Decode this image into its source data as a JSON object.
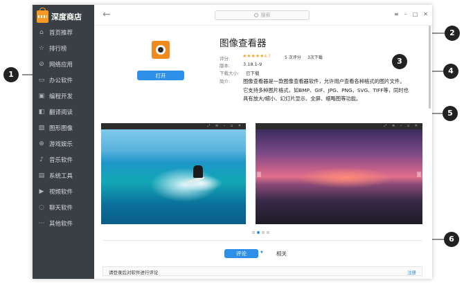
{
  "sidebar": {
    "brand": "深度商店",
    "items": [
      {
        "label": "首页推荐",
        "icon": "home-icon"
      },
      {
        "label": "排行榜",
        "icon": "star-icon"
      },
      {
        "label": "网络应用",
        "icon": "globe-icon"
      },
      {
        "label": "办公软件",
        "icon": "document-icon"
      },
      {
        "label": "编程开发",
        "icon": "code-icon"
      },
      {
        "label": "翻译阅读",
        "icon": "book-icon"
      },
      {
        "label": "图形图像",
        "icon": "image-icon"
      },
      {
        "label": "游戏娱乐",
        "icon": "gamepad-icon"
      },
      {
        "label": "音乐软件",
        "icon": "music-icon"
      },
      {
        "label": "系统工具",
        "icon": "tools-icon"
      },
      {
        "label": "视频软件",
        "icon": "video-icon"
      },
      {
        "label": "聊天软件",
        "icon": "chat-icon"
      },
      {
        "label": "其他软件",
        "icon": "more-icon"
      }
    ]
  },
  "titlebar": {
    "search_placeholder": "搜索"
  },
  "app": {
    "name": "图像查看器",
    "open_label": "打开",
    "rating_label": "评分:",
    "rating_value": "4.7",
    "rating_stars": 5,
    "ratings_count": "5 次评分",
    "downloads": "3次下载",
    "version_label": "版本:",
    "version": "3.18.1-9",
    "size_label": "下载大小:",
    "size_value": "已下载",
    "desc_label": "简介:",
    "description": "图像查看器是一款图像查看器软件，允许用户查看各种格式的图片文件。它支持多种图片格式，如BMP、GIF、JPG、PNG、SVG、TIFF等，同时也具有放大/缩小、幻灯片显示、全屏、缩略图等功能。"
  },
  "screenshots": {
    "count": 4,
    "active_index": 1
  },
  "tabs": {
    "comments": "评论",
    "related": "相关"
  },
  "login": {
    "message": "请登录后对软件进行评论",
    "register": "注册"
  },
  "callouts": [
    "1",
    "2",
    "3",
    "4",
    "5",
    "6"
  ],
  "colors": {
    "accent": "#2d8fe8",
    "sidebar": "#3a3f45",
    "star": "#f5a623"
  }
}
